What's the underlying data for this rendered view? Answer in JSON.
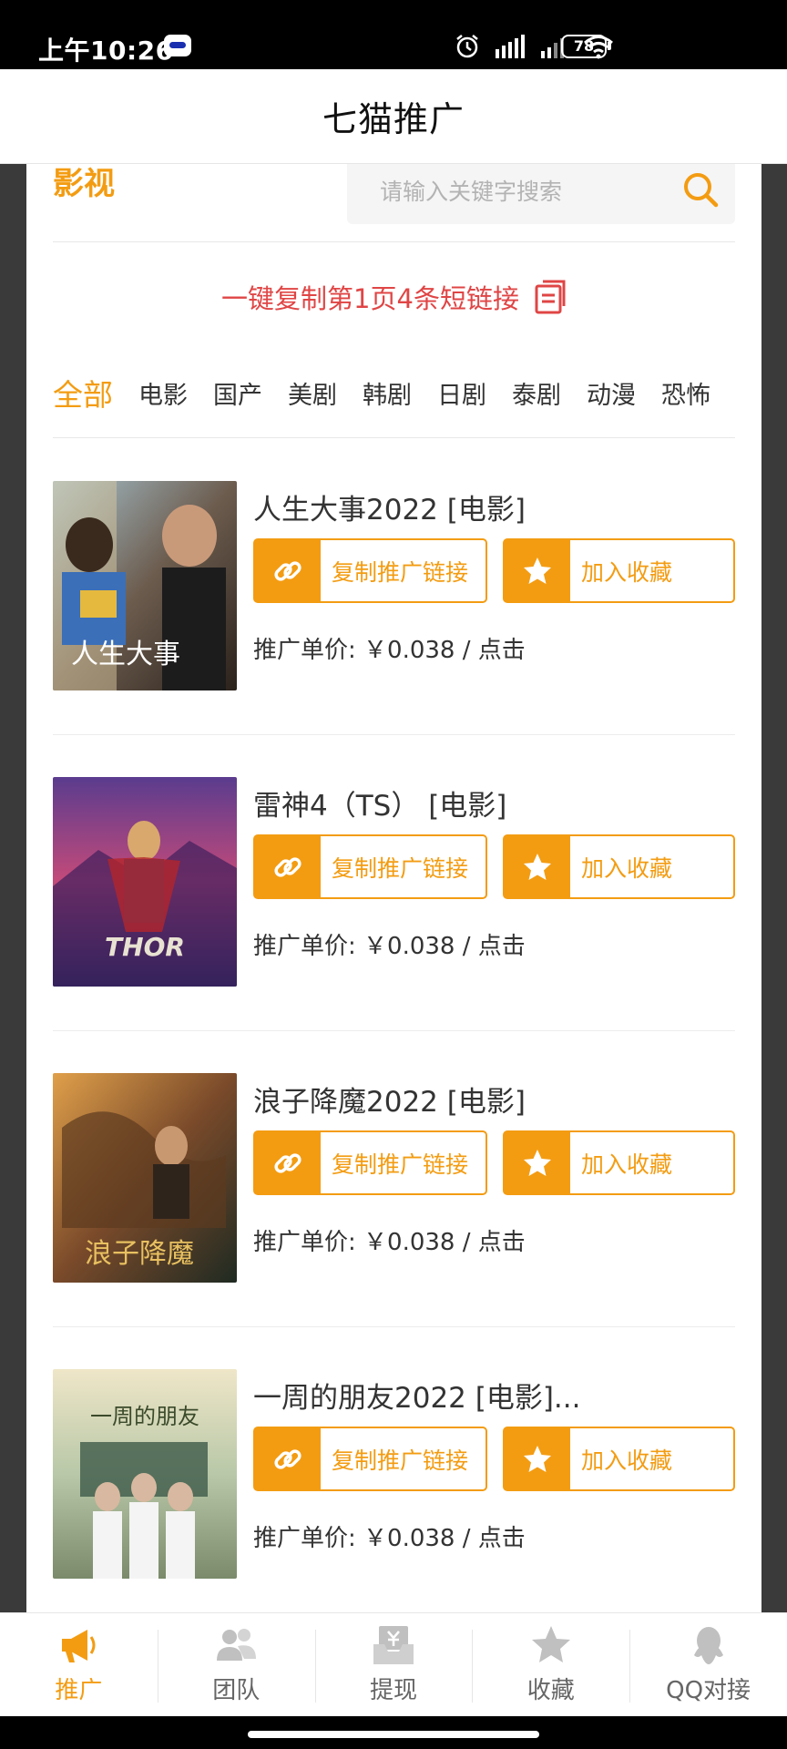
{
  "status_bar": {
    "time": "上午10:26",
    "battery": "78"
  },
  "header": {
    "title": "七猫推广"
  },
  "search": {
    "brand": "影视",
    "placeholder": "请输入关键字搜索"
  },
  "copy_all": {
    "label": "一键复制第1页4条短链接"
  },
  "tabs": [
    {
      "label": "全部",
      "active": true
    },
    {
      "label": "电影"
    },
    {
      "label": "国产"
    },
    {
      "label": "美剧"
    },
    {
      "label": "韩剧"
    },
    {
      "label": "日剧"
    },
    {
      "label": "泰剧"
    },
    {
      "label": "动漫"
    },
    {
      "label": "恐怖"
    }
  ],
  "items": [
    {
      "title": "人生大事2022 [电影]",
      "copy_label": "复制推广链接",
      "fav_label": "加入收藏",
      "price": "推广单价: ￥0.038 / 点击",
      "poster_text": "人生大事"
    },
    {
      "title": "雷神4（TS） [电影]",
      "copy_label": "复制推广链接",
      "fav_label": "加入收藏",
      "price": "推广单价: ￥0.038 / 点击",
      "poster_text": "THOR"
    },
    {
      "title": "浪子降魔2022 [电影]",
      "copy_label": "复制推广链接",
      "fav_label": "加入收藏",
      "price": "推广单价: ￥0.038 / 点击",
      "poster_text": "浪子降魔"
    },
    {
      "title": "一周的朋友2022 [电影]...",
      "copy_label": "复制推广链接",
      "fav_label": "加入收藏",
      "price": "推广单价: ￥0.038 / 点击",
      "poster_text": "一周的朋友"
    }
  ],
  "bottom_nav": [
    {
      "label": "推广",
      "icon": "megaphone-icon",
      "active": true
    },
    {
      "label": "团队",
      "icon": "team-icon"
    },
    {
      "label": "提现",
      "icon": "withdraw-icon"
    },
    {
      "label": "收藏",
      "icon": "star-icon"
    },
    {
      "label": "QQ对接",
      "icon": "qq-icon"
    }
  ],
  "colors": {
    "accent": "#f39c12",
    "link_red": "#e04545"
  }
}
